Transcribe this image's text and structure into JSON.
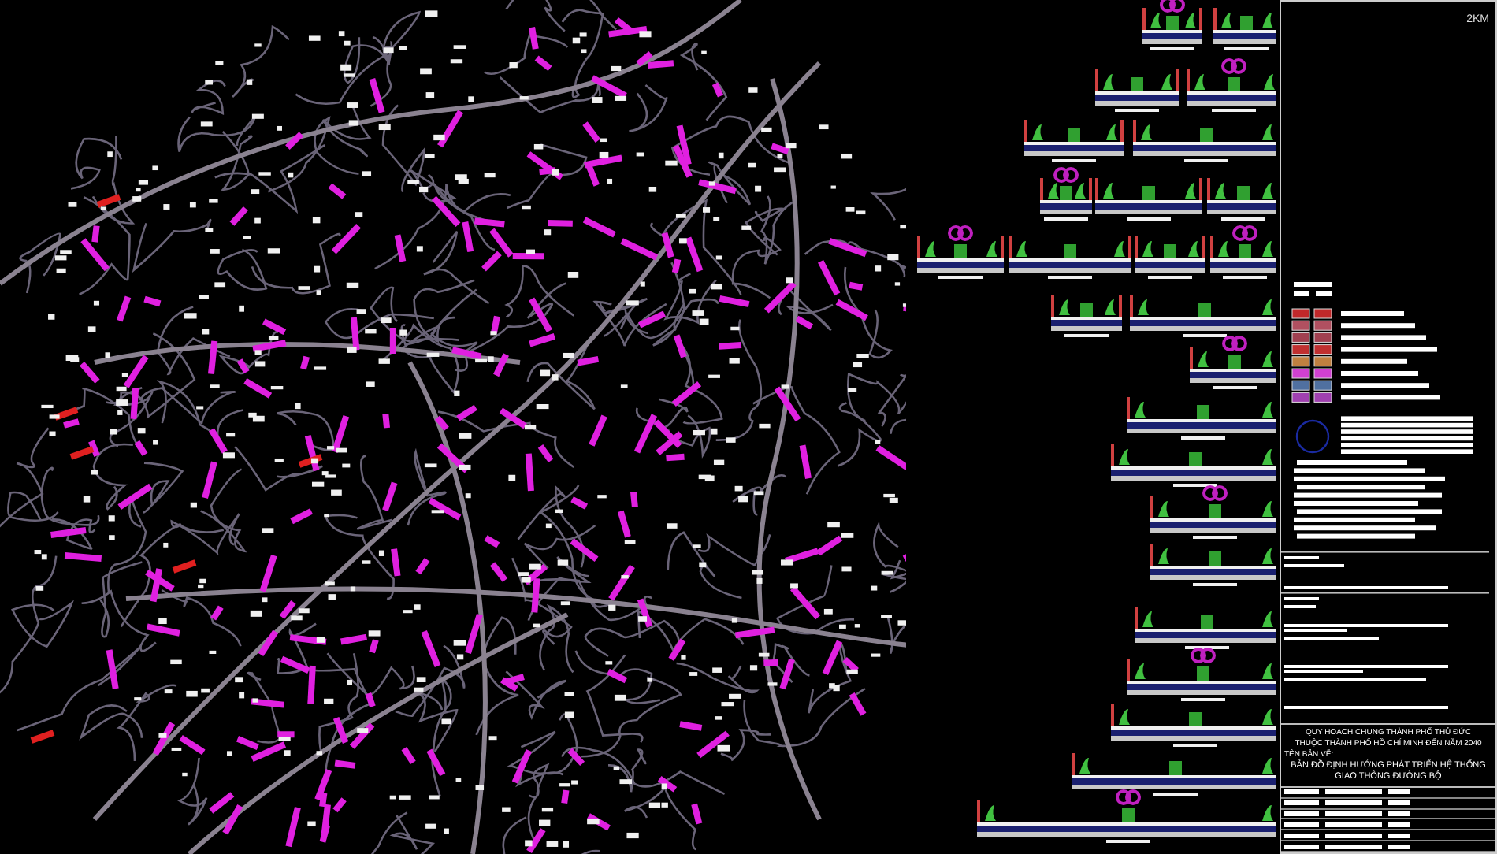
{
  "scale_label": "2KM",
  "title_block": {
    "plan_title": [
      "QUY HOẠCH CHUNG THÀNH PHỐ THỦ ĐỨC",
      "THUỘC THÀNH PHỐ HỒ CHÍ MINH ĐẾN NĂM 2040"
    ],
    "drawing_name_label": "TÊN BẢN VẼ:",
    "drawing_name": [
      "BẢN ĐỒ ĐỊNH HƯỚNG PHÁT TRIỂN HỆ THỐNG",
      "GIAO THÔNG ĐƯỜNG BỘ"
    ]
  }
}
